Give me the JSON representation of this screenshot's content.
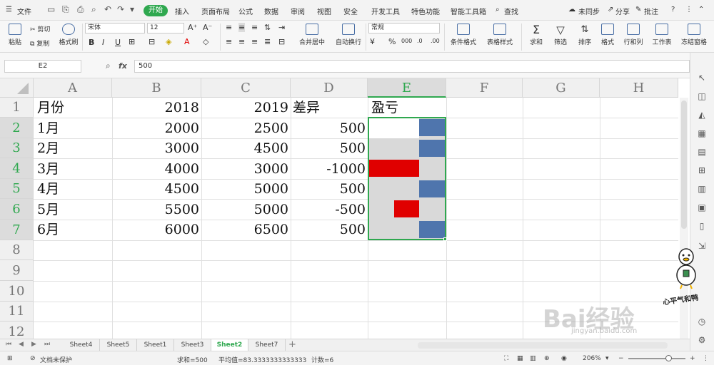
{
  "menubar": {
    "file": "文件",
    "tabs": [
      "开始",
      "插入",
      "页面布局",
      "公式",
      "数据",
      "审阅",
      "视图",
      "安全",
      "开发工具",
      "特色功能",
      "智能工具箱"
    ],
    "search": "查找",
    "sync": "未同步",
    "share": "分享",
    "comment": "批注"
  },
  "ribbon": {
    "paste": "粘贴",
    "cut": "剪切",
    "copy": "复制",
    "format_painter": "格式刷",
    "font_name": "宋体",
    "font_size": "12",
    "merge": "合并居中",
    "wrap": "自动换行",
    "number_format": "常规",
    "cond_format": "条件格式",
    "table_style": "表格样式",
    "sum": "求和",
    "filter": "筛选",
    "sort": "排序",
    "format": "格式",
    "rowcol": "行和列",
    "worksheet": "工作表",
    "freeze": "冻结窗格"
  },
  "formula_bar": {
    "name_box": "E2",
    "fx": "fx",
    "value": "500"
  },
  "grid": {
    "columns": [
      "A",
      "B",
      "C",
      "D",
      "E",
      "F",
      "G",
      "H"
    ],
    "rows": [
      "1",
      "2",
      "3",
      "4",
      "5",
      "6",
      "7",
      "8",
      "9",
      "10",
      "11",
      "12"
    ],
    "header_row": [
      "月份",
      "2018",
      "2019",
      "差异",
      "盈亏"
    ],
    "data": [
      [
        "1月",
        "2000",
        "2500",
        "500"
      ],
      [
        "2月",
        "3000",
        "4500",
        "500"
      ],
      [
        "3月",
        "4000",
        "3000",
        "-1000"
      ],
      [
        "4月",
        "4500",
        "5000",
        "500"
      ],
      [
        "5月",
        "5500",
        "5000",
        "-500"
      ],
      [
        "6月",
        "6000",
        "6500",
        "500"
      ]
    ],
    "databar_values": [
      500,
      500,
      -1000,
      500,
      -500,
      500
    ],
    "databar_positive_color": "#4f75ad",
    "databar_negative_color": "#e00000"
  },
  "sheets": {
    "tabs": [
      "Sheet4",
      "Sheet5",
      "Sheet1",
      "Sheet3",
      "Sheet2",
      "Sheet7"
    ],
    "active": "Sheet2"
  },
  "status": {
    "protect": "文档未保护",
    "sum": "求和=500",
    "avg": "平均值=83.3333333333333",
    "count": "计数=6",
    "zoom": "206%"
  },
  "watermark": {
    "sign": "心平气和鸭",
    "brand": "Bai经验",
    "url": "jingyan.baidu.com"
  }
}
